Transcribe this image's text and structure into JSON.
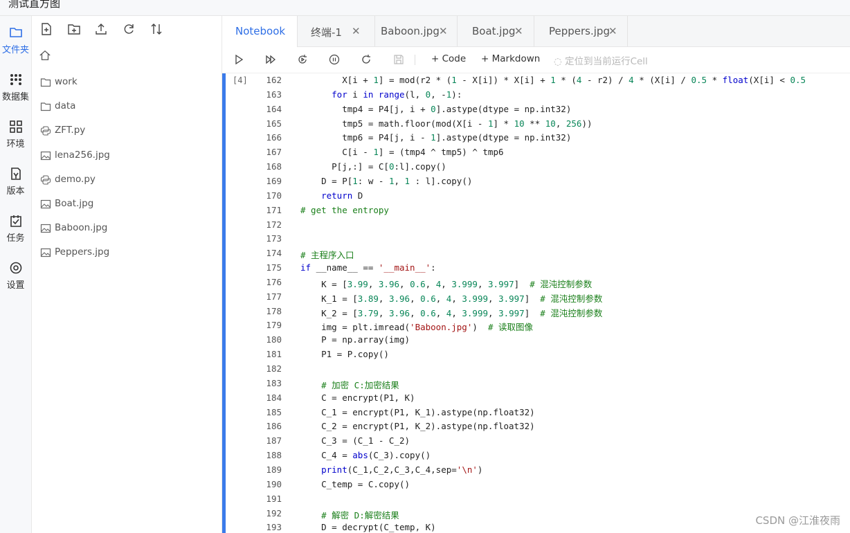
{
  "window": {
    "title": "测试直方图"
  },
  "activity": [
    {
      "label": "文件夹",
      "icon": "folder-icon",
      "active": true
    },
    {
      "label": "数据集",
      "icon": "dataset-icon"
    },
    {
      "label": "环境",
      "icon": "environment-icon"
    },
    {
      "label": "版本",
      "icon": "version-icon"
    },
    {
      "label": "任务",
      "icon": "task-icon"
    },
    {
      "label": "设置",
      "icon": "settings-icon"
    }
  ],
  "files": {
    "toolbar": [
      "new-file-icon",
      "new-folder-icon",
      "upload-icon",
      "refresh-icon",
      "sort-icon"
    ],
    "items": [
      {
        "name": "work",
        "type": "folder"
      },
      {
        "name": "data",
        "type": "folder"
      },
      {
        "name": "ZFT.py",
        "type": "python"
      },
      {
        "name": "lena256.jpg",
        "type": "image"
      },
      {
        "name": "demo.py",
        "type": "python"
      },
      {
        "name": "Boat.jpg",
        "type": "image"
      },
      {
        "name": "Baboon.jpg",
        "type": "image"
      },
      {
        "name": "Peppers.jpg",
        "type": "image"
      }
    ]
  },
  "tabs": [
    {
      "label": "Notebook",
      "closable": false,
      "active": true
    },
    {
      "label": "终端-1",
      "closable": true
    },
    {
      "label": "Baboon.jpg",
      "closable": true
    },
    {
      "label": "Boat.jpg",
      "closable": true
    },
    {
      "label": "Peppers.jpg",
      "closable": true
    }
  ],
  "toolbar": {
    "code_label": "Code",
    "markdown_label": "Markdown",
    "locate_label": "定位到当前运行Cell"
  },
  "cell": {
    "exec_count": "[4]"
  },
  "code_lines": [
    {
      "n": "162",
      "t": [
        [
          "        X[i + ",
          ""
        ],
        [
          "1",
          "num"
        ],
        [
          "] = mod(r2 * (",
          ""
        ],
        [
          "1",
          "num"
        ],
        [
          " - X[i]) * X[i] + ",
          ""
        ],
        [
          "1",
          "num"
        ],
        [
          " * (",
          ""
        ],
        [
          "4",
          "num"
        ],
        [
          " - r2) / ",
          ""
        ],
        [
          "4",
          "num"
        ],
        [
          " * (X[i] / ",
          ""
        ],
        [
          "0.5",
          "num"
        ],
        [
          " * ",
          ""
        ],
        [
          "float",
          "kw"
        ],
        [
          "(X[i] < ",
          ""
        ],
        [
          "0.5",
          "num"
        ]
      ]
    },
    {
      "n": "163",
      "t": [
        [
          "      ",
          ""
        ],
        [
          "for",
          "kw"
        ],
        [
          " i ",
          ""
        ],
        [
          "in",
          "kw"
        ],
        [
          " ",
          ""
        ],
        [
          "range",
          "kw"
        ],
        [
          "(l, ",
          ""
        ],
        [
          "0",
          "num"
        ],
        [
          ", -",
          ""
        ],
        [
          "1",
          "num"
        ],
        [
          "):",
          ""
        ]
      ]
    },
    {
      "n": "164",
      "t": [
        [
          "        tmp4 = P4[j, i + ",
          ""
        ],
        [
          "0",
          "num"
        ],
        [
          "].astype(dtype = np.int32)",
          ""
        ]
      ]
    },
    {
      "n": "165",
      "t": [
        [
          "        tmp5 = math.floor(mod(X[i - ",
          ""
        ],
        [
          "1",
          "num"
        ],
        [
          "] * ",
          ""
        ],
        [
          "10",
          "num"
        ],
        [
          " ** ",
          ""
        ],
        [
          "10",
          "num"
        ],
        [
          ", ",
          ""
        ],
        [
          "256",
          "num"
        ],
        [
          "))",
          ""
        ]
      ]
    },
    {
      "n": "166",
      "t": [
        [
          "        tmp6 = P4[j, i - ",
          ""
        ],
        [
          "1",
          "num"
        ],
        [
          "].astype(dtype = np.int32)",
          ""
        ]
      ]
    },
    {
      "n": "167",
      "t": [
        [
          "        C[i - ",
          ""
        ],
        [
          "1",
          "num"
        ],
        [
          "] = (tmp4 ^ tmp5) ^ tmp6",
          ""
        ]
      ]
    },
    {
      "n": "168",
      "t": [
        [
          "      P[j,:] = C[",
          ""
        ],
        [
          "0",
          "num"
        ],
        [
          ":l].copy()",
          ""
        ]
      ]
    },
    {
      "n": "169",
      "t": [
        [
          "    D = P[",
          ""
        ],
        [
          "1",
          "num"
        ],
        [
          ": w - ",
          ""
        ],
        [
          "1",
          "num"
        ],
        [
          ", ",
          ""
        ],
        [
          "1",
          "num"
        ],
        [
          " : l].copy()",
          ""
        ]
      ]
    },
    {
      "n": "170",
      "t": [
        [
          "    ",
          ""
        ],
        [
          "return",
          "kw"
        ],
        [
          " D",
          ""
        ]
      ]
    },
    {
      "n": "171",
      "t": [
        [
          "# get the entropy",
          "cmt"
        ]
      ]
    },
    {
      "n": "172",
      "t": []
    },
    {
      "n": "173",
      "t": []
    },
    {
      "n": "174",
      "t": [
        [
          "# 主程序入口",
          "cmt"
        ]
      ]
    },
    {
      "n": "175",
      "t": [
        [
          "if",
          "kw"
        ],
        [
          " __name__ == ",
          ""
        ],
        [
          "'__main__'",
          "str"
        ],
        [
          ":",
          ""
        ]
      ]
    },
    {
      "n": "176",
      "t": [
        [
          "    K = [",
          ""
        ],
        [
          "3.99",
          "num"
        ],
        [
          ", ",
          ""
        ],
        [
          "3.96",
          "num"
        ],
        [
          ", ",
          ""
        ],
        [
          "0.6",
          "num"
        ],
        [
          ", ",
          ""
        ],
        [
          "4",
          "num"
        ],
        [
          ", ",
          ""
        ],
        [
          "3.999",
          "num"
        ],
        [
          ", ",
          ""
        ],
        [
          "3.997",
          "num"
        ],
        [
          "]  ",
          ""
        ],
        [
          "# 混沌控制参数",
          "cmt"
        ]
      ]
    },
    {
      "n": "177",
      "t": [
        [
          "    K_1 = [",
          ""
        ],
        [
          "3.89",
          "num"
        ],
        [
          ", ",
          ""
        ],
        [
          "3.96",
          "num"
        ],
        [
          ", ",
          ""
        ],
        [
          "0.6",
          "num"
        ],
        [
          ", ",
          ""
        ],
        [
          "4",
          "num"
        ],
        [
          ", ",
          ""
        ],
        [
          "3.999",
          "num"
        ],
        [
          ", ",
          ""
        ],
        [
          "3.997",
          "num"
        ],
        [
          "]  ",
          ""
        ],
        [
          "# 混沌控制参数",
          "cmt"
        ]
      ]
    },
    {
      "n": "178",
      "t": [
        [
          "    K_2 = [",
          ""
        ],
        [
          "3.79",
          "num"
        ],
        [
          ", ",
          ""
        ],
        [
          "3.96",
          "num"
        ],
        [
          ", ",
          ""
        ],
        [
          "0.6",
          "num"
        ],
        [
          ", ",
          ""
        ],
        [
          "4",
          "num"
        ],
        [
          ", ",
          ""
        ],
        [
          "3.999",
          "num"
        ],
        [
          ", ",
          ""
        ],
        [
          "3.997",
          "num"
        ],
        [
          "]  ",
          ""
        ],
        [
          "# 混沌控制参数",
          "cmt"
        ]
      ]
    },
    {
      "n": "179",
      "t": [
        [
          "    img = plt.imread(",
          ""
        ],
        [
          "'Baboon.jpg'",
          "str"
        ],
        [
          ")  ",
          ""
        ],
        [
          "# 读取图像",
          "cmt"
        ]
      ]
    },
    {
      "n": "180",
      "t": [
        [
          "    P = np.array(img)",
          ""
        ]
      ]
    },
    {
      "n": "181",
      "t": [
        [
          "    P1 = P.copy()",
          ""
        ]
      ]
    },
    {
      "n": "182",
      "t": []
    },
    {
      "n": "183",
      "t": [
        [
          "    ",
          ""
        ],
        [
          "# 加密 C:加密结果",
          "cmt"
        ]
      ]
    },
    {
      "n": "184",
      "t": [
        [
          "    C = encrypt(P1, K)",
          ""
        ]
      ]
    },
    {
      "n": "185",
      "t": [
        [
          "    C_1 = encrypt(P1, K_1).astype(np.float32)",
          ""
        ]
      ]
    },
    {
      "n": "186",
      "t": [
        [
          "    C_2 = encrypt(P1, K_2).astype(np.float32)",
          ""
        ]
      ]
    },
    {
      "n": "187",
      "t": [
        [
          "    C_3 = (C_1 - C_2)",
          ""
        ]
      ]
    },
    {
      "n": "188",
      "t": [
        [
          "    C_4 = ",
          ""
        ],
        [
          "abs",
          "kw"
        ],
        [
          "(C_3).copy()",
          ""
        ]
      ]
    },
    {
      "n": "189",
      "t": [
        [
          "    ",
          ""
        ],
        [
          "print",
          "kw"
        ],
        [
          "(C_1,C_2,C_3,C_4,sep=",
          ""
        ],
        [
          "'\\n'",
          "str"
        ],
        [
          ")",
          ""
        ]
      ]
    },
    {
      "n": "190",
      "t": [
        [
          "    C_temp = C.copy()",
          ""
        ]
      ]
    },
    {
      "n": "191",
      "t": []
    },
    {
      "n": "192",
      "t": [
        [
          "    ",
          ""
        ],
        [
          "# 解密 D:解密结果",
          "cmt"
        ]
      ]
    },
    {
      "n": "193",
      "t": [
        [
          "    D = decrypt(C_temp, K)",
          ""
        ]
      ]
    }
  ],
  "watermark": "CSDN @江淮夜雨"
}
